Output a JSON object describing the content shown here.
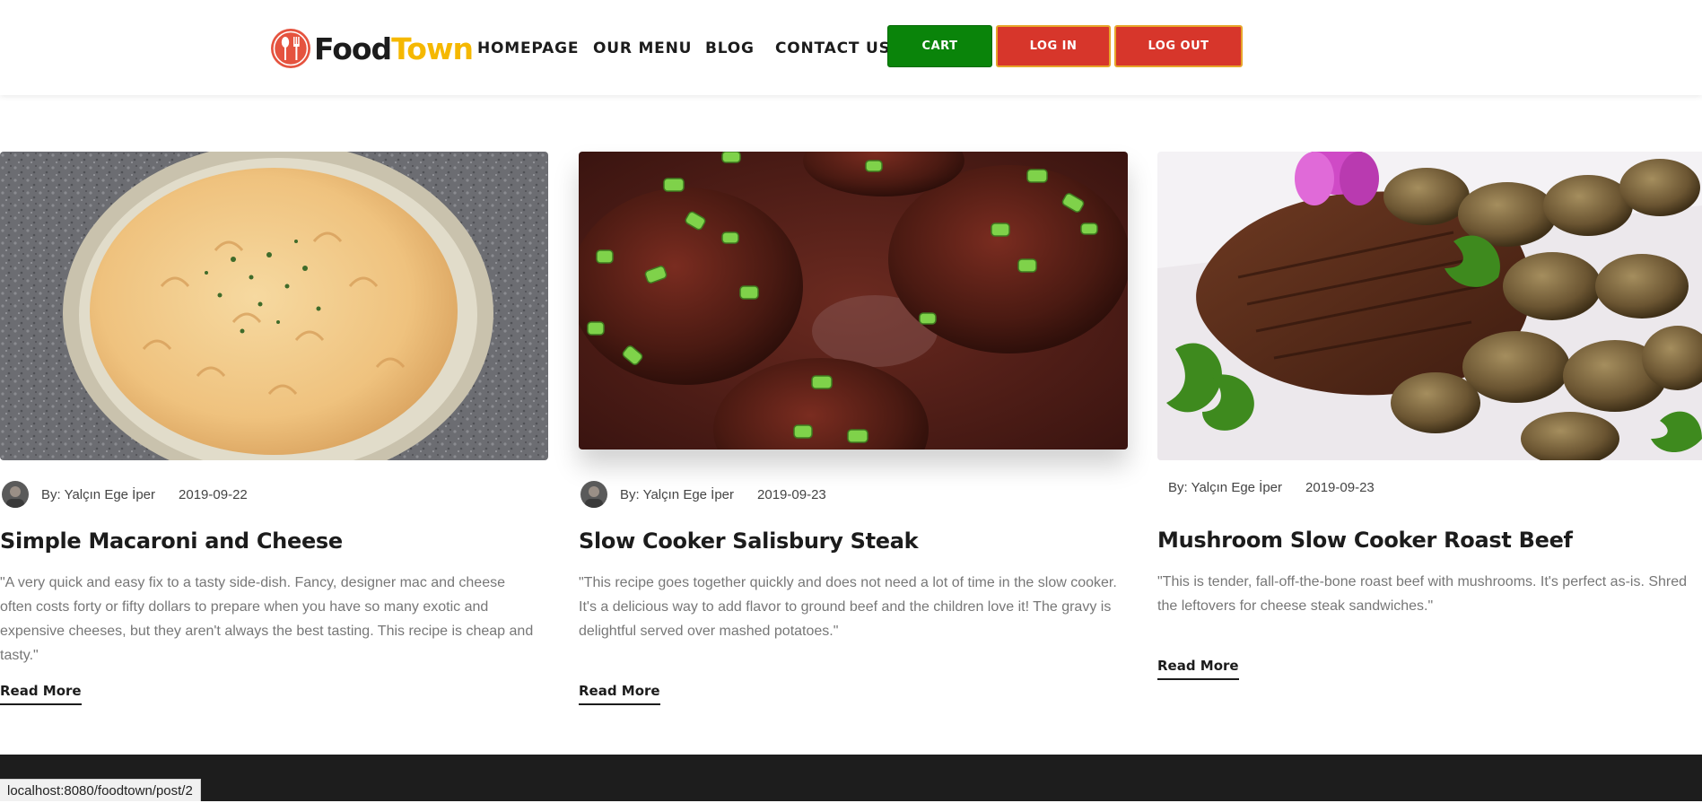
{
  "brand": {
    "name_part1": "Food",
    "name_part2": "Town",
    "colors": {
      "dark": "#1c1c1c",
      "accent": "#f5b800",
      "logo_red": "#e5533f"
    }
  },
  "nav": {
    "items": [
      "HOMEPAGE",
      "OUR MENU",
      "BLOG",
      "CONTACT US"
    ]
  },
  "buttons": {
    "cart": "CART",
    "login": "LOG IN",
    "logout": "LOG OUT",
    "colors": {
      "cart": "#0a840a",
      "auth": "#d7362b",
      "auth_border": "#e7a52a"
    }
  },
  "posts": [
    {
      "image_icon": "mac-and-cheese-photo",
      "author": "By: Yalçın Ege İper",
      "date": "2019-09-22",
      "title": "Simple Macaroni and Cheese",
      "excerpt": "\"A very quick and easy fix to a tasty side-dish. Fancy, designer mac and cheese often costs forty or fifty dollars to prepare when you have so many exotic and expensive cheeses, but they aren't always the best tasting. This recipe is cheap and tasty.\"",
      "read_more": "Read More"
    },
    {
      "image_icon": "salisbury-steak-photo",
      "author": "By: Yalçın Ege İper",
      "date": "2019-09-23",
      "title": "Slow Cooker Salisbury Steak",
      "excerpt": "\"This recipe goes together quickly and does not need a lot of time in the slow cooker. It's a delicious way to add flavor to ground beef and the children love it! The gravy is delightful served over mashed potatoes.\"",
      "read_more": "Read More"
    },
    {
      "image_icon": "roast-beef-photo",
      "author": "By: Yalçın Ege İper",
      "date": "2019-09-23",
      "title": "Mushroom Slow Cooker Roast Beef",
      "excerpt": "\"This is tender, fall-off-the-bone roast beef with mushrooms. It's perfect as-is. Shred the leftovers for cheese steak sandwiches.\"",
      "read_more": "Read More"
    }
  ],
  "status_bar": {
    "url": "localhost:8080/foodtown/post/2"
  }
}
